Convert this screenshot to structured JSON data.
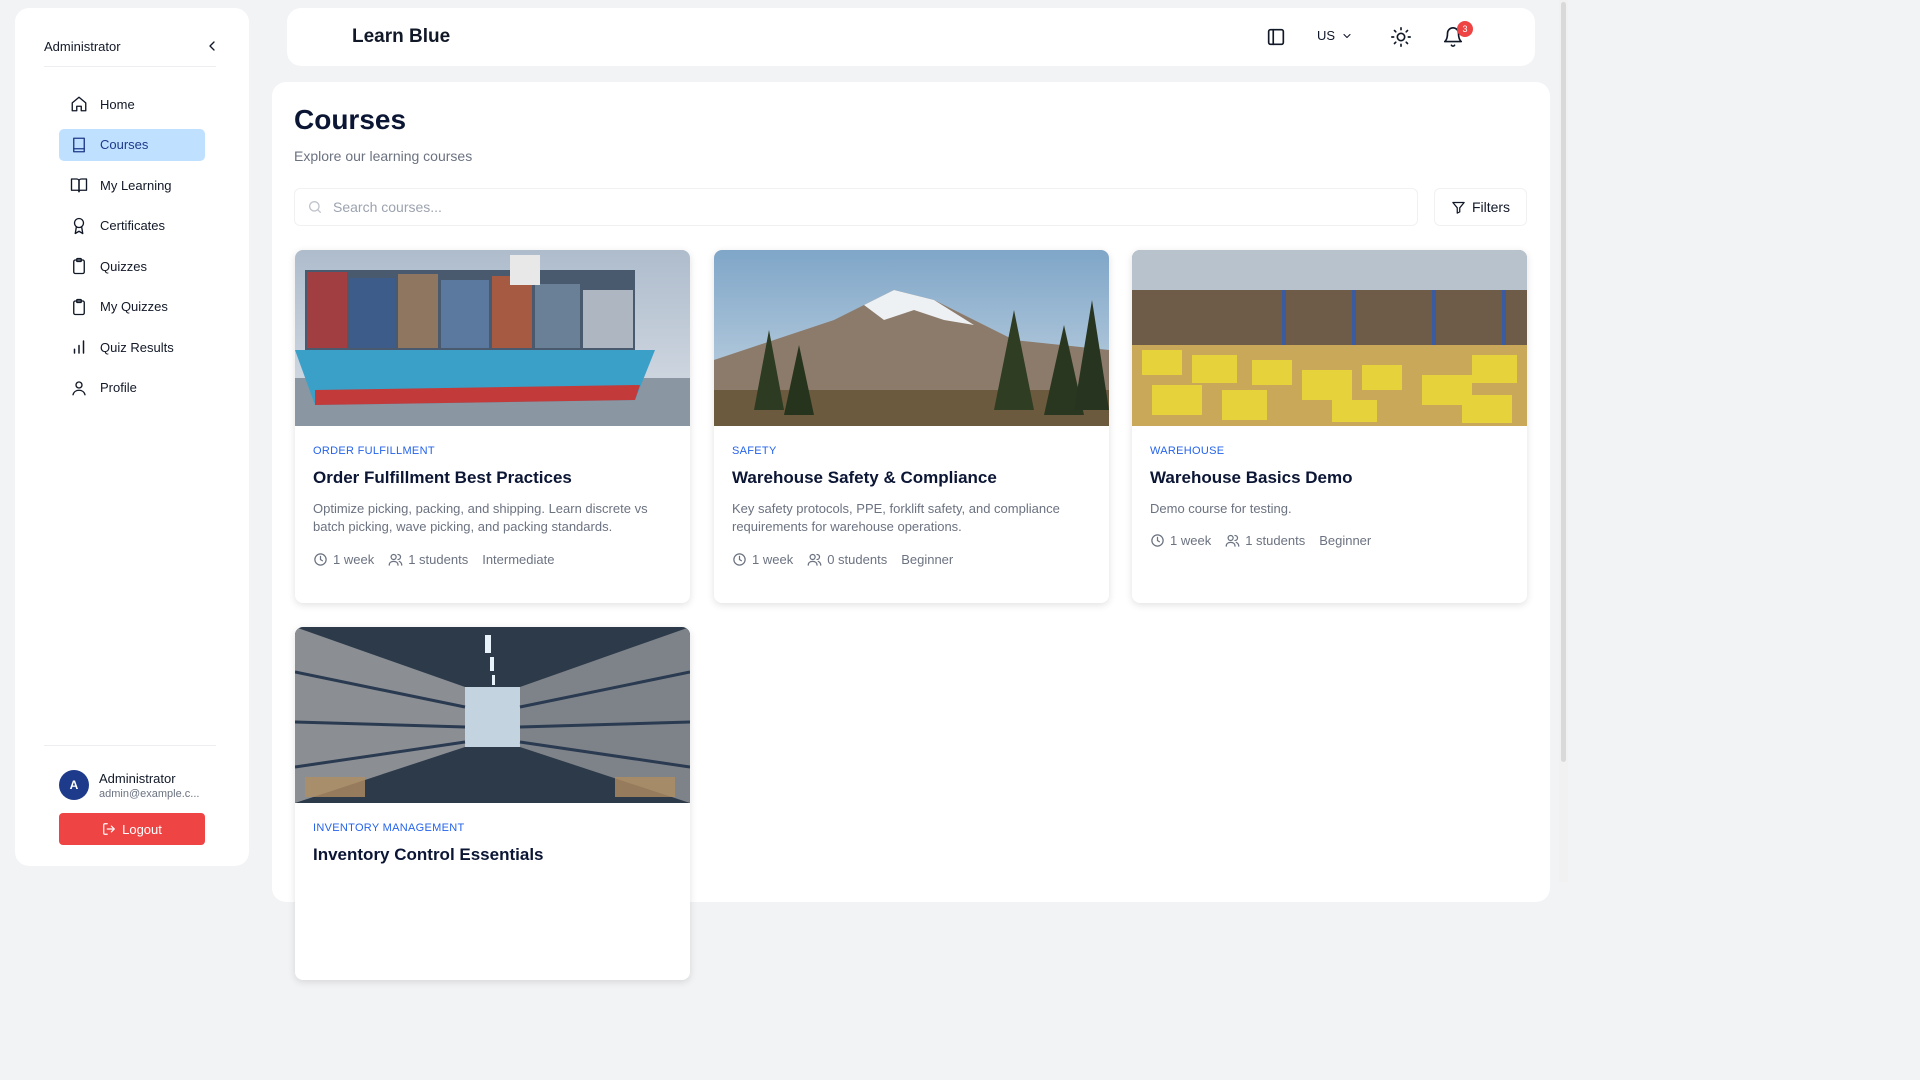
{
  "sidebar": {
    "title": "Administrator",
    "items": [
      {
        "label": "Home",
        "icon": "home-icon"
      },
      {
        "label": "Courses",
        "icon": "book-icon",
        "active": true
      },
      {
        "label": "My Learning",
        "icon": "book-open-icon"
      },
      {
        "label": "Certificates",
        "icon": "award-icon"
      },
      {
        "label": "Quizzes",
        "icon": "clipboard-icon"
      },
      {
        "label": "My Quizzes",
        "icon": "clipboard-icon"
      },
      {
        "label": "Quiz Results",
        "icon": "bar-chart-icon"
      },
      {
        "label": "Profile",
        "icon": "user-icon"
      }
    ],
    "user": {
      "initial": "A",
      "name": "Administrator",
      "email": "admin@example.c..."
    },
    "logout_label": "Logout"
  },
  "header": {
    "brand": "Learn Blue",
    "language": "US",
    "notification_count": "3"
  },
  "main": {
    "title": "Courses",
    "subtitle": "Explore our learning courses",
    "search_placeholder": "Search courses...",
    "filters_label": "Filters",
    "courses": [
      {
        "category": "ORDER FULFILLMENT",
        "title": "Order Fulfillment Best Practices",
        "description": "Optimize picking, packing, and shipping. Learn discrete vs batch picking, wave picking, and packing standards.",
        "duration": "1 week",
        "students": "1 students",
        "level": "Intermediate"
      },
      {
        "category": "SAFETY",
        "title": "Warehouse Safety & Compliance",
        "description": "Key safety protocols, PPE, forklift safety, and compliance requirements for warehouse operations.",
        "duration": "1 week",
        "students": "0 students",
        "level": "Beginner"
      },
      {
        "category": "WAREHOUSE",
        "title": "Warehouse Basics Demo",
        "description": "Demo course for testing.",
        "duration": "1 week",
        "students": "1 students",
        "level": "Beginner"
      },
      {
        "category": "INVENTORY MANAGEMENT",
        "title": "Inventory Control Essentials",
        "description": "",
        "duration": "",
        "students": "",
        "level": ""
      }
    ]
  },
  "colors": {
    "accent": "#2563eb",
    "active_nav_bg": "#bfe0ff",
    "logout": "#ef4444",
    "heading": "#0b1534"
  }
}
